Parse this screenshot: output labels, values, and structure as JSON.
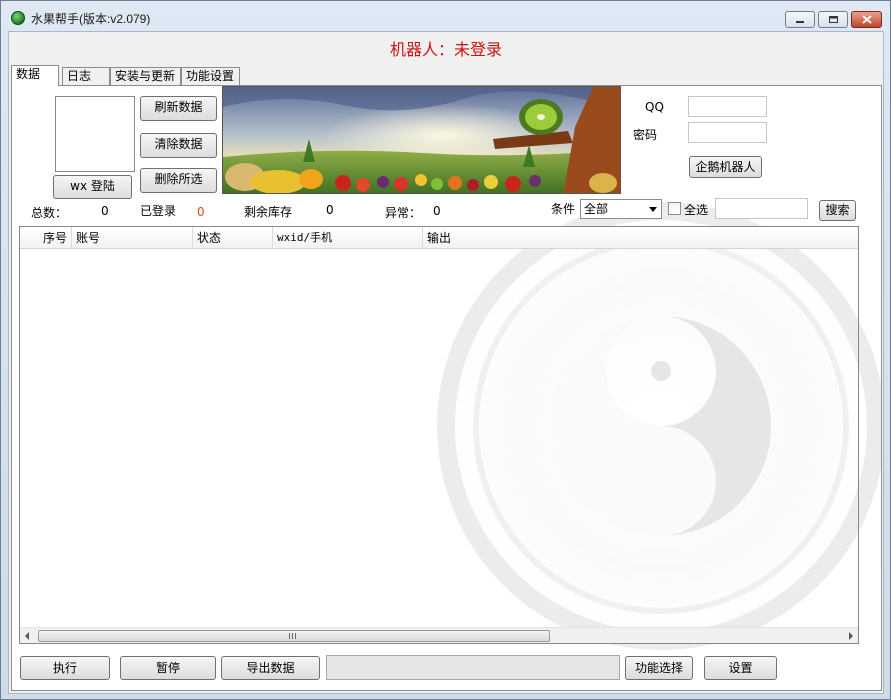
{
  "window": {
    "title": "水果帮手(版本:v2.079)"
  },
  "robot_status": "机器人：未登录",
  "tabs": [
    {
      "label": "数据"
    },
    {
      "label": "日志"
    },
    {
      "label": "安装与更新"
    },
    {
      "label": "功能设置"
    }
  ],
  "data_panel": {
    "wx_login_button": "wx 登陆",
    "refresh_button": "刷新数据",
    "clear_button": "清除数据",
    "delete_selected_button": "删除所选",
    "qq_label": "QQ",
    "qq_value": "",
    "password_label": "密码",
    "password_value": "",
    "penguin_robot_button": "企鹅机器人",
    "stats": {
      "total_label": "总数：",
      "total_value": "0",
      "logged_in_label": "已登录",
      "logged_in_value": "0",
      "remaining_label": "剩余库存",
      "remaining_value": "0",
      "abnormal_label": "异常：",
      "abnormal_value": "0"
    },
    "filter": {
      "condition_label": "条件",
      "condition_value": "全部",
      "select_all_label": "全选",
      "select_all_checked": false,
      "search_value": "",
      "search_button": "搜索"
    },
    "table": {
      "columns": [
        "序号",
        "账号",
        "状态",
        "wxid/手机",
        "输出"
      ],
      "rows": []
    }
  },
  "footer": {
    "execute_button": "执行",
    "pause_button": "暂停",
    "export_button": "导出数据",
    "progress_value": 0,
    "function_select_button": "功能选择",
    "settings_button": "设置"
  },
  "colors": {
    "status_red": "#cc1111",
    "logged_in_value": "#e04a10"
  }
}
